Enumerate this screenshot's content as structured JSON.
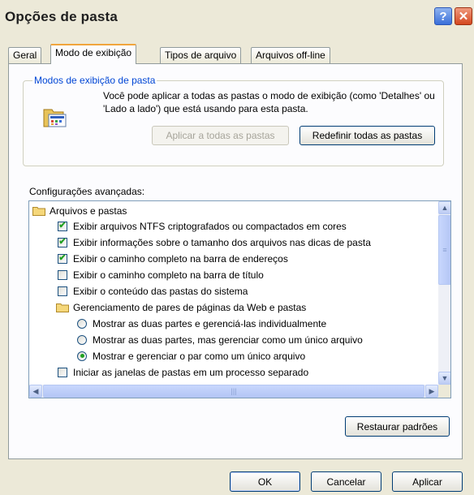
{
  "window": {
    "title": "Opções de pasta",
    "help": "?",
    "close": "✕"
  },
  "tabs": [
    {
      "label": "Geral"
    },
    {
      "label": "Modo de exibição"
    },
    {
      "label": "Tipos de arquivo"
    },
    {
      "label": "Arquivos off-line"
    }
  ],
  "folder_views": {
    "legend": "Modos de exibição de pasta",
    "description": "Você pode aplicar a todas as pastas o modo de exibição (como 'Detalhes' ou 'Lado a lado') que está usando para esta pasta.",
    "apply_all_label": "Aplicar a todas as pastas",
    "reset_all_label": "Redefinir todas as pastas"
  },
  "advanced": {
    "label": "Configurações avançadas:",
    "items": [
      {
        "kind": "folder",
        "label": "Arquivos e pastas"
      },
      {
        "kind": "checkbox",
        "checked": true,
        "label": "Exibir arquivos NTFS criptografados ou compactados em cores"
      },
      {
        "kind": "checkbox",
        "checked": true,
        "label": "Exibir informações sobre o tamanho dos arquivos nas dicas de pasta"
      },
      {
        "kind": "checkbox",
        "checked": true,
        "label": "Exibir o caminho completo na barra de endereços"
      },
      {
        "kind": "checkbox",
        "checked": false,
        "label": "Exibir o caminho completo na barra de título"
      },
      {
        "kind": "checkbox",
        "checked": false,
        "label": "Exibir o conteúdo das pastas do sistema"
      },
      {
        "kind": "folder",
        "label": "Gerenciamento de pares de páginas da Web e pastas"
      },
      {
        "kind": "radio",
        "checked": false,
        "label": "Mostrar as duas partes e gerenciá-las individualmente"
      },
      {
        "kind": "radio",
        "checked": false,
        "label": "Mostrar as duas partes, mas gerenciar como um único arquivo"
      },
      {
        "kind": "radio",
        "checked": true,
        "label": "Mostrar e gerenciar o par como um único arquivo"
      },
      {
        "kind": "checkbox",
        "checked": false,
        "label": "Iniciar as janelas de pastas em um processo separado"
      }
    ],
    "restore_label": "Restaurar padrões"
  },
  "footer": {
    "ok_label": "OK",
    "cancel_label": "Cancelar",
    "apply_label": "Aplicar"
  },
  "colors": {
    "accent_tab": "#f1a53c",
    "legend": "#0046d5",
    "check": "#21a121"
  }
}
